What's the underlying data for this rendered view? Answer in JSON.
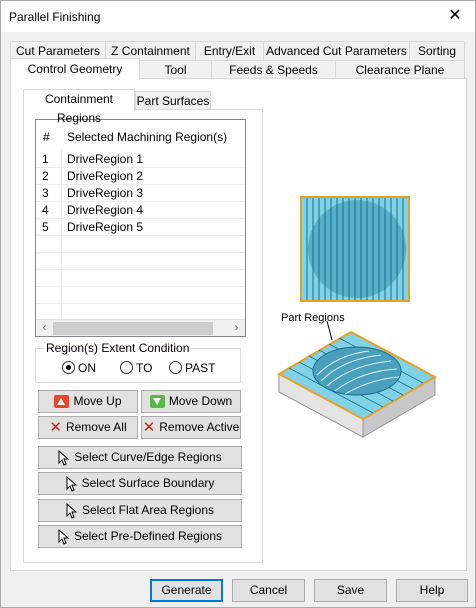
{
  "window": {
    "title": "Parallel Finishing",
    "close_glyph": "✕"
  },
  "tabs_row1": [
    "Cut Parameters",
    "Z Containment",
    "Entry/Exit",
    "Advanced Cut Parameters",
    "Sorting"
  ],
  "tabs_row2": [
    "Control Geometry",
    "Tool",
    "Feeds & Speeds",
    "Clearance Plane"
  ],
  "active_tab": "Control Geometry",
  "subtabs": [
    "Containment Regions",
    "Part Surfaces"
  ],
  "active_subtab": "Containment Regions",
  "regions_table": {
    "columns": [
      "#",
      "Selected Machining Region(s)"
    ],
    "rows": [
      {
        "num": "1",
        "name": "DriveRegion 1"
      },
      {
        "num": "2",
        "name": "DriveRegion 2"
      },
      {
        "num": "3",
        "name": "DriveRegion 3"
      },
      {
        "num": "4",
        "name": "DriveRegion 4"
      },
      {
        "num": "5",
        "name": "DriveRegion 5"
      }
    ],
    "scroll_left": "‹",
    "scroll_right": "›"
  },
  "extent_condition": {
    "legend": "Region(s) Extent Condition",
    "options": [
      "ON",
      "TO",
      "PAST"
    ],
    "selected": "ON"
  },
  "buttons": {
    "move_up": "Move Up",
    "move_down": "Move Down",
    "remove_all": "Remove All",
    "remove_active": "Remove Active",
    "select_curve_edge": "Select Curve/Edge Regions",
    "select_surface_boundary": "Select Surface Boundary",
    "select_flat_area": "Select Flat Area Regions",
    "select_predefined": "Select Pre-Defined Regions"
  },
  "illustration": {
    "label": "Part Regions"
  },
  "footer": {
    "generate": "Generate",
    "cancel": "Cancel",
    "save": "Save",
    "help": "Help"
  },
  "colors": {
    "accent": "#0078d7",
    "region_fill": "#7fd2e8",
    "region_outline": "#e8a020",
    "toolpath_line": "#1b6f86"
  }
}
